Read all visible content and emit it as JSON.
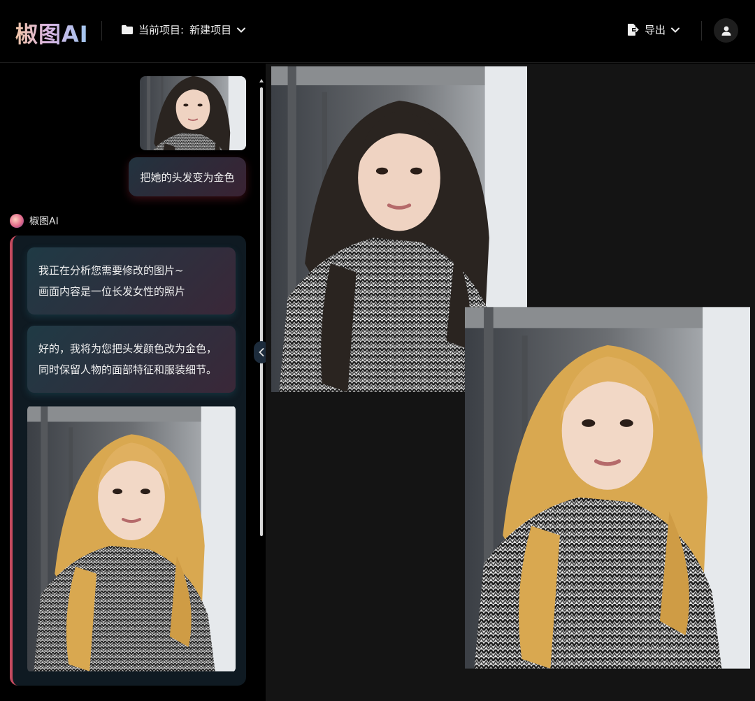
{
  "header": {
    "logo_text": "椒图AI",
    "project_label": "当前项目:",
    "project_name": "新建项目",
    "export_label": "导出"
  },
  "chat": {
    "user_message": "把她的头发变为金色",
    "ai_name": "椒图AI",
    "ai_messages": [
      {
        "line1": "我正在分析您需要修改的图片~",
        "line2": "画面内容是一位长发女性的照片"
      },
      {
        "line1": "好的，我将为您把头发颜色改为金色，",
        "line2": "同时保留人物的面部特征和服装细节。"
      }
    ]
  },
  "icons": {
    "folder": "folder-icon",
    "project_dropdown": "chevron-down-icon",
    "export": "export-icon",
    "export_dropdown": "chevron-down-icon",
    "user": "user-icon",
    "collapse": "chevron-left-icon"
  },
  "colors": {
    "background": "#000000",
    "canvas": "#141414",
    "accent_border": "#c44a5e",
    "hair_original": "#2a2420",
    "hair_golden": "#d9a850"
  }
}
